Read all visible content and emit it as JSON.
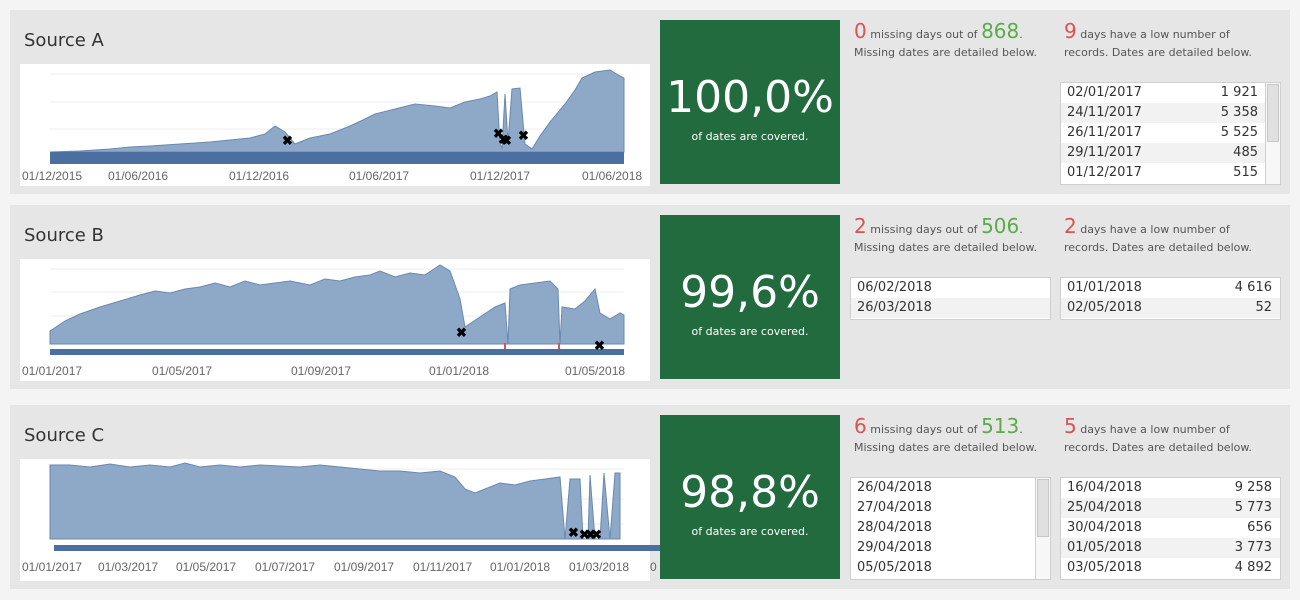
{
  "covered_label": "of dates are covered.",
  "missing_text": "missing days out of",
  "missing_text2": "Missing dates are detailed below.",
  "low_text": "days have a low number of",
  "low_text2": "records. Dates are detailed below.",
  "colors": {
    "area": "#8ea8c8",
    "area_line": "#6a88b0",
    "band": "#4a6fa0",
    "coverage_bg": "#226b3e",
    "red": "#d9534f",
    "green": "#5aab4a"
  },
  "sources": [
    {
      "name": "Source A",
      "coverage": "100,0%",
      "missing": "0",
      "total": "868",
      "low_count": "9",
      "missing_dates": [],
      "low_dates": [
        {
          "date": "02/01/2017",
          "count": "1 921"
        },
        {
          "date": "24/11/2017",
          "count": "5 358"
        },
        {
          "date": "26/11/2017",
          "count": "5 525"
        },
        {
          "date": "29/11/2017",
          "count": "485"
        },
        {
          "date": "01/12/2017",
          "count": "515"
        }
      ],
      "x_ticks": [
        "01/12/2015",
        "01/06/2016",
        "01/12/2016",
        "01/06/2017",
        "01/12/2017",
        "01/06/2018"
      ]
    },
    {
      "name": "Source B",
      "coverage": "99,6%",
      "missing": "2",
      "total": "506",
      "low_count": "2",
      "missing_dates": [
        "06/02/2018",
        "26/03/2018"
      ],
      "low_dates": [
        {
          "date": "01/01/2018",
          "count": "4 616"
        },
        {
          "date": "02/05/2018",
          "count": "52"
        }
      ],
      "x_ticks": [
        "01/01/2017",
        "01/05/2017",
        "01/09/2017",
        "01/01/2018",
        "01/05/2018"
      ]
    },
    {
      "name": "Source C",
      "coverage": "98,8%",
      "missing": "6",
      "total": "513",
      "low_count": "5",
      "missing_dates": [
        "26/04/2018",
        "27/04/2018",
        "28/04/2018",
        "29/04/2018",
        "05/05/2018"
      ],
      "low_dates": [
        {
          "date": "16/04/2018",
          "count": "9 258"
        },
        {
          "date": "25/04/2018",
          "count": "5 773"
        },
        {
          "date": "30/04/2018",
          "count": "656"
        },
        {
          "date": "01/05/2018",
          "count": "3 773"
        },
        {
          "date": "03/05/2018",
          "count": "4 892"
        }
      ],
      "x_ticks": [
        "01/01/2017",
        "01/03/2017",
        "01/05/2017",
        "01/07/2017",
        "01/09/2017",
        "01/11/2017",
        "01/01/2018",
        "01/03/2018",
        "0"
      ]
    }
  ]
}
